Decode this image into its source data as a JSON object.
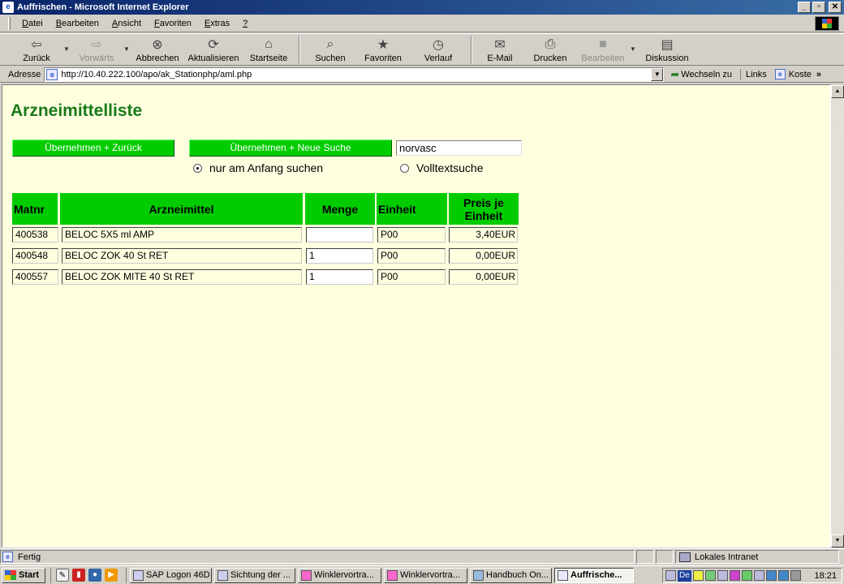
{
  "window": {
    "title": "Auffrischen - Microsoft Internet Explorer"
  },
  "menu": [
    "Datei",
    "Bearbeiten",
    "Ansicht",
    "Favoriten",
    "Extras",
    "?"
  ],
  "toolbar": {
    "back": "Zurück",
    "forward": "Vorwärts",
    "stop": "Abbrechen",
    "refresh": "Aktualisieren",
    "home": "Startseite",
    "search": "Suchen",
    "favorites": "Favoriten",
    "history": "Verlauf",
    "mail": "E-Mail",
    "print": "Drucken",
    "edit": "Bearbeiten",
    "discuss": "Diskussion"
  },
  "address": {
    "label": "Adresse",
    "url": "http://10.40.222.100/apo/ak_Stationphp/aml.php",
    "go": "Wechseln zu",
    "links": "Links",
    "link1": "Koste"
  },
  "page": {
    "title": "Arzneimittelliste",
    "btn_apply_back": "Übernehmen + Zurück",
    "btn_apply_new": "Übernehmen + Neue Suche",
    "search_value": "norvasc",
    "radio_start": "nur am Anfang suchen",
    "radio_fulltext": "Volltextsuche",
    "radio_selected": "start"
  },
  "table": {
    "headers": {
      "matnr": "Matnr",
      "drug": "Arzneimittel",
      "qty": "Menge",
      "unit": "Einheit",
      "price_l1": "Preis je",
      "price_l2": "Einheit"
    },
    "rows": [
      {
        "matnr": "400538",
        "name": "BELOC 5X5 ml AMP",
        "qty": "",
        "unit": "P00",
        "price": "3,40EUR"
      },
      {
        "matnr": "400548",
        "name": "BELOC ZOK 40 St RET",
        "qty": "1",
        "unit": "P00",
        "price": "0,00EUR"
      },
      {
        "matnr": "400557",
        "name": "BELOC ZOK MITE 40 St RET",
        "qty": "1",
        "unit": "P00",
        "price": "0,00EUR"
      }
    ]
  },
  "status": {
    "text": "Fertig",
    "zone": "Lokales Intranet"
  },
  "taskbar": {
    "start": "Start",
    "tasks": [
      "SAP Logon 46D",
      "Sichtung der ...",
      "Winklervortra...",
      "Winklervortra...",
      "Handbuch On...",
      "Auffrische..."
    ],
    "lang": "De",
    "clock": "18:21"
  },
  "colors": {
    "accent_green": "#00cc00",
    "title_green": "#1a7a1a",
    "page_bg": "#ffffe0"
  }
}
